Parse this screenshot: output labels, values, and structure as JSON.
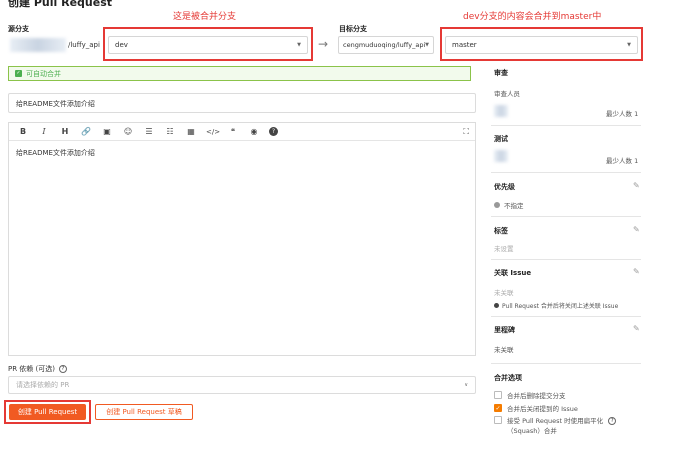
{
  "page": {
    "title": "创建 Pull Request"
  },
  "annotations": {
    "merged_branch_note": "这是被合并分支",
    "target_note": "dev分支的内容会合并到master中"
  },
  "source": {
    "label": "源分支",
    "repo": "/luffy_api",
    "branch": "dev"
  },
  "arrow": "→",
  "target": {
    "label": "目标分支",
    "repo": "cengmuduoqing/luffy_api",
    "branch": "master"
  },
  "status": {
    "mergeable": "可自动合并"
  },
  "pr": {
    "title_value": "给README文件添加介绍",
    "body_value": "给README文件添加介绍"
  },
  "toolbar": [
    "B",
    "I",
    "H",
    "🔗",
    "▣",
    "☺",
    "☰",
    "☷",
    "▦",
    "</>",
    "❝",
    "◉",
    "?"
  ],
  "dependency": {
    "label": "PR 依赖 (可选)",
    "placeholder": "请选择依赖的 PR"
  },
  "buttons": {
    "create": "创建 Pull Request",
    "draft": "创建 Pull Request 草稿"
  },
  "sidebar": {
    "review": {
      "heading": "审查",
      "sub": "审查人员",
      "min": "最少人数 1"
    },
    "test": {
      "heading": "测试",
      "min": "最少人数 1"
    },
    "priority": {
      "heading": "优先级",
      "value": "不指定"
    },
    "labels": {
      "heading": "标签",
      "value": "未设置"
    },
    "issue": {
      "heading": "关联 Issue",
      "value": "未关联",
      "note": "Pull Request 合并后将关闭上述关联 Issue"
    },
    "milestone": {
      "heading": "里程碑",
      "value": "未关联"
    },
    "merge": {
      "heading": "合并选项",
      "options": [
        {
          "label": "合并后删除提交分支",
          "checked": false
        },
        {
          "label": "合并后关闭提到的 Issue",
          "checked": true
        },
        {
          "label": "接受 Pull Request 时使用扁平化",
          "checked": false
        }
      ],
      "option3_line2": "（Squash）合并"
    }
  },
  "colors": {
    "accent": "#f15a22",
    "annotation": "#e53935",
    "success": "#4caf50"
  }
}
